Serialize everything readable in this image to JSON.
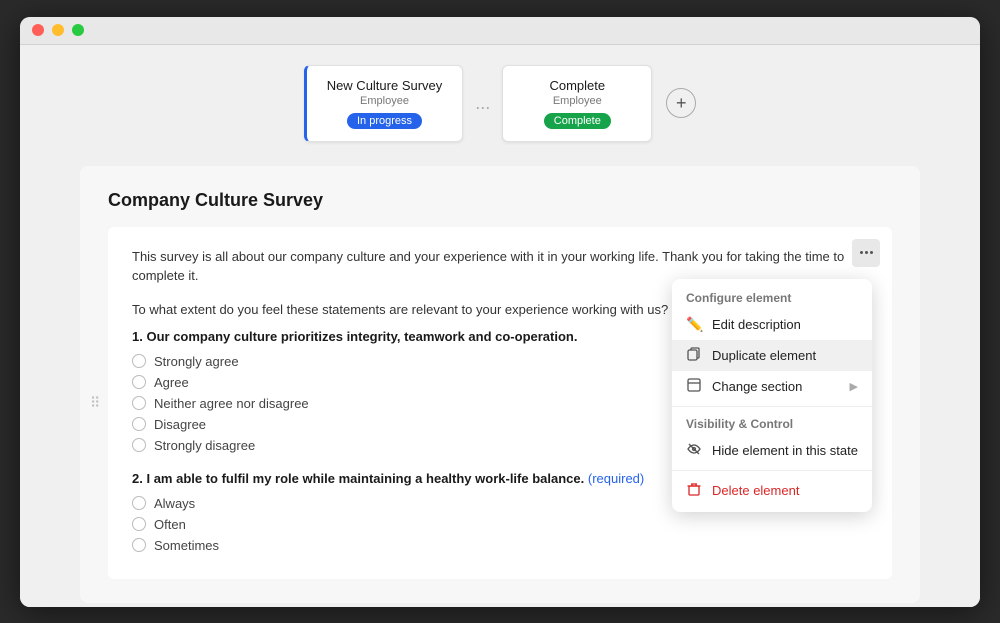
{
  "window": {
    "titlebar": {
      "lights": [
        "red",
        "yellow",
        "green"
      ]
    }
  },
  "tabs": [
    {
      "title": "New Culture Survey",
      "subtitle": "Employee",
      "badge": "In progress",
      "badgeType": "inprogress",
      "active": true
    },
    {
      "title": "Complete",
      "subtitle": "Employee",
      "badge": "Complete",
      "badgeType": "complete",
      "active": false
    }
  ],
  "add_tab_label": "+",
  "tabs_separator": "...",
  "survey": {
    "title": "Company Culture Survey",
    "intro": "This survey is all about our company culture and your experience with it in your working life. Thank you for taking the time to complete it.",
    "question_prompt": "To what extent do you feel these statements are relevant to your experience working with us?",
    "questions": [
      {
        "number": "1",
        "text": "Our company culture prioritizes integrity, teamwork and co-operation.",
        "options": [
          "Strongly agree",
          "Agree",
          "Neither agree nor disagree",
          "Disagree",
          "Strongly disagree"
        ]
      },
      {
        "number": "2",
        "text": "I am able to fulfil my role while maintaining a healthy work-life balance.",
        "required": true,
        "required_label": "(required)",
        "options": [
          "Always",
          "Often",
          "Sometimes"
        ]
      }
    ]
  },
  "context_menu": {
    "section1_label": "Configure element",
    "items": [
      {
        "icon": "✏️",
        "label": "Edit description",
        "has_arrow": false,
        "destructive": false
      },
      {
        "icon": "🗂️",
        "label": "Duplicate element",
        "has_arrow": false,
        "destructive": false,
        "highlighted": true
      },
      {
        "icon": "📋",
        "label": "Change section",
        "has_arrow": true,
        "destructive": false
      }
    ],
    "section2_label": "Visibility & Control",
    "items2": [
      {
        "icon": "👁️",
        "label": "Hide element in this state",
        "has_arrow": false,
        "destructive": false
      }
    ],
    "destructive_item": {
      "icon": "🗑️",
      "label": "Delete element",
      "destructive": true
    }
  }
}
